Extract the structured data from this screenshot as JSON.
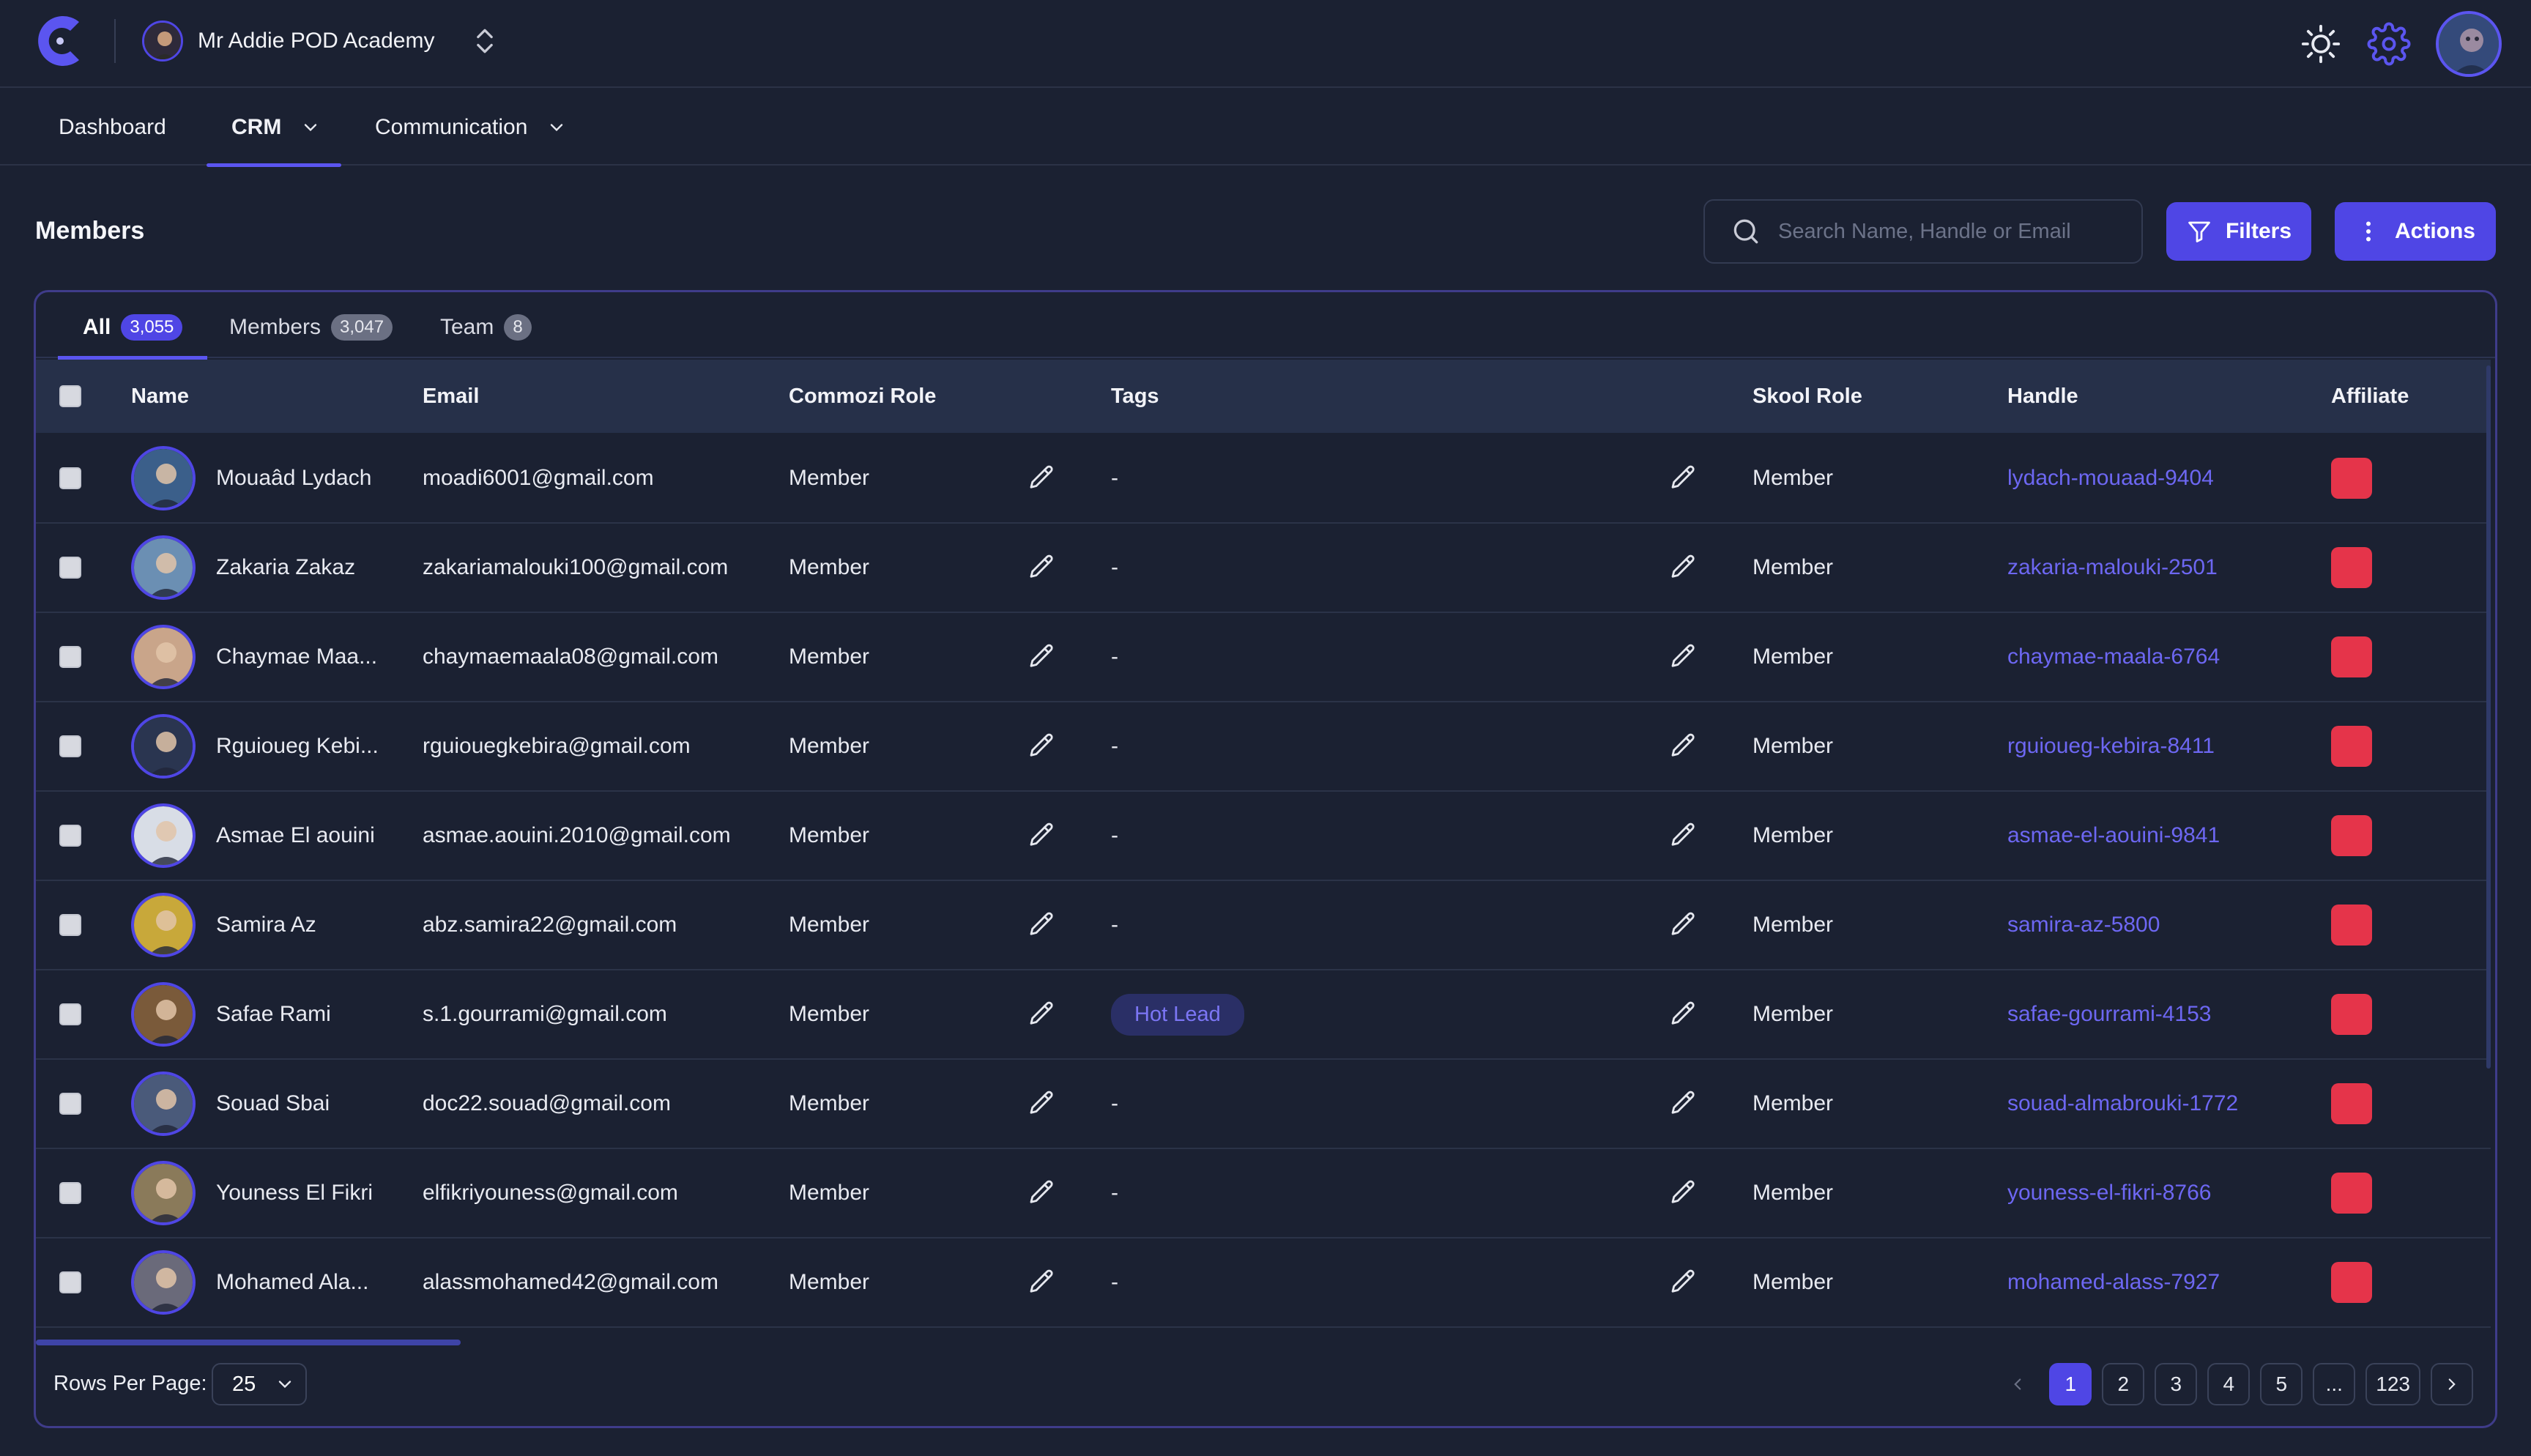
{
  "workspace": {
    "name": "Mr Addie POD Academy"
  },
  "nav": {
    "items": [
      {
        "label": "Dashboard"
      },
      {
        "label": "CRM"
      },
      {
        "label": "Communication"
      }
    ]
  },
  "page": {
    "title": "Members",
    "search_placeholder": "Search Name, Handle or Email",
    "filters_label": "Filters",
    "actions_label": "Actions"
  },
  "tabs": [
    {
      "label": "All",
      "count": "3,055"
    },
    {
      "label": "Members",
      "count": "3,047"
    },
    {
      "label": "Team",
      "count": "8"
    }
  ],
  "columns": {
    "name": "Name",
    "email": "Email",
    "commozi_role": "Commozi Role",
    "tags": "Tags",
    "skool_role": "Skool Role",
    "handle": "Handle",
    "affiliate": "Affiliate"
  },
  "rows": [
    {
      "name": "Mouaâd Lydach",
      "email": "moadi6001@gmail.com",
      "commozi_role": "Member",
      "tags": "-",
      "skool_role": "Member",
      "handle": "lydach-mouaad-9404"
    },
    {
      "name": "Zakaria Zakaz",
      "email": "zakariamalouki100@gmail.com",
      "commozi_role": "Member",
      "tags": "-",
      "skool_role": "Member",
      "handle": "zakaria-malouki-2501"
    },
    {
      "name": "Chaymae Maa...",
      "email": "chaymaemaala08@gmail.com",
      "commozi_role": "Member",
      "tags": "-",
      "skool_role": "Member",
      "handle": "chaymae-maala-6764"
    },
    {
      "name": "Rguioueg Kebi...",
      "email": "rguiouegkebira@gmail.com",
      "commozi_role": "Member",
      "tags": "-",
      "skool_role": "Member",
      "handle": "rguioueg-kebira-8411"
    },
    {
      "name": "Asmae El aouini",
      "email": "asmae.aouini.2010@gmail.com",
      "commozi_role": "Member",
      "tags": "-",
      "skool_role": "Member",
      "handle": "asmae-el-aouini-9841"
    },
    {
      "name": "Samira Az",
      "email": "abz.samira22@gmail.com",
      "commozi_role": "Member",
      "tags": "-",
      "skool_role": "Member",
      "handle": "samira-az-5800"
    },
    {
      "name": "Safae Rami",
      "email": "s.1.gourrami@gmail.com",
      "commozi_role": "Member",
      "tags": "Hot Lead",
      "skool_role": "Member",
      "handle": "safae-gourrami-4153"
    },
    {
      "name": "Souad Sbai",
      "email": "doc22.souad@gmail.com",
      "commozi_role": "Member",
      "tags": "-",
      "skool_role": "Member",
      "handle": "souad-almabrouki-1772"
    },
    {
      "name": "Youness El Fikri",
      "email": "elfikriyouness@gmail.com",
      "commozi_role": "Member",
      "tags": "-",
      "skool_role": "Member",
      "handle": "youness-el-fikri-8766"
    },
    {
      "name": "Mohamed Ala...",
      "email": "alassmohamed42@gmail.com",
      "commozi_role": "Member",
      "tags": "-",
      "skool_role": "Member",
      "handle": "mohamed-alass-7927"
    }
  ],
  "avatar_colors": [
    "#3b5f8a",
    "#6b8fb3",
    "#c9a58a",
    "#2a3550",
    "#d8dde6",
    "#c8a83a",
    "#7a5a3a",
    "#4a5a7a",
    "#8a7a5a",
    "#6a6a7a"
  ],
  "footer": {
    "rows_per_page_label": "Rows Per Page:",
    "rows_per_page_value": "25",
    "pages": [
      "1",
      "2",
      "3",
      "4",
      "5",
      "...",
      "123"
    ]
  },
  "colors": {
    "accent": "#4f46e5",
    "affiliate": "#e5344a",
    "background": "#1b2132"
  }
}
